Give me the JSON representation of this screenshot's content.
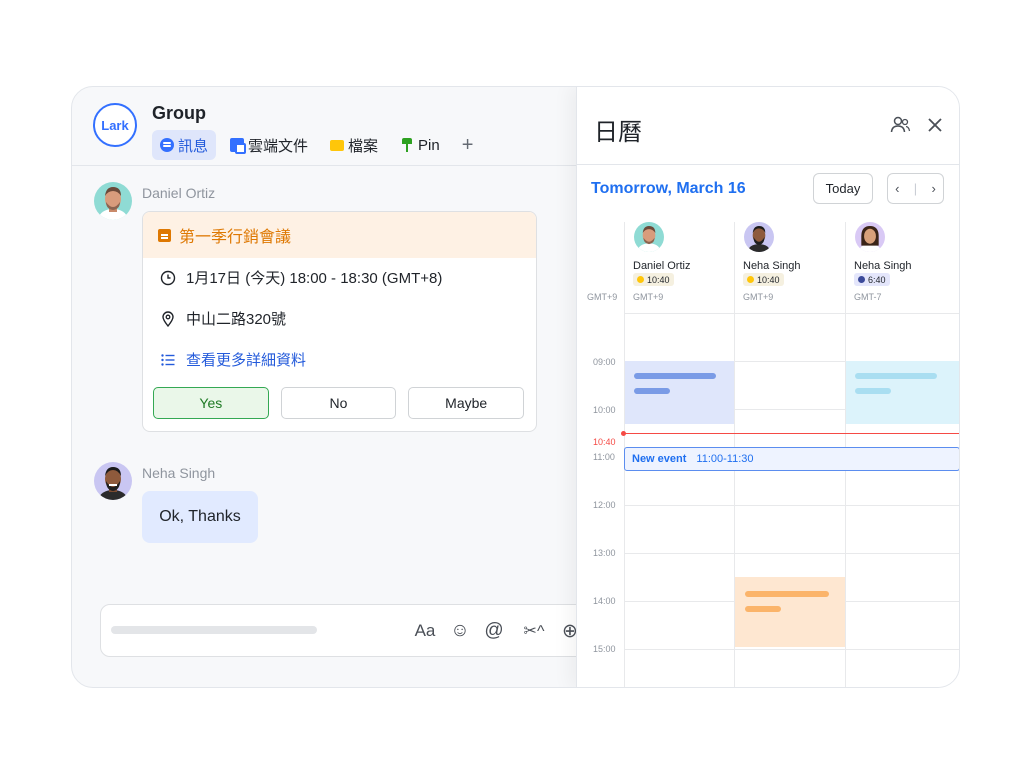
{
  "chat": {
    "logo": "Lark",
    "title": "Group",
    "tabs": [
      {
        "label": "訊息",
        "icon": "message-icon"
      },
      {
        "label": "雲端文件",
        "icon": "doc-icon"
      },
      {
        "label": "檔案",
        "icon": "folder-icon"
      },
      {
        "label": "Pin",
        "icon": "pin-icon"
      },
      {
        "label": "+",
        "icon": "plus-icon"
      }
    ],
    "messages": [
      {
        "sender": "Daniel Ortiz"
      },
      {
        "sender": "Neha Singh",
        "text": "Ok, Thanks"
      }
    ],
    "event": {
      "title": "第一季行銷會議",
      "time": "1月17日 (今天) 18:00 - 18:30 (GMT+8)",
      "location": "中山二路320號",
      "details_link": "查看更多詳細資料",
      "rsvp": {
        "yes": "Yes",
        "no": "No",
        "maybe": "Maybe"
      }
    },
    "composer": {
      "tools": [
        "Aa",
        "☺",
        "@",
        "✂^",
        "⊕"
      ]
    }
  },
  "calendar": {
    "title": "日曆",
    "date": "Tomorrow, March 16",
    "today_label": "Today",
    "prev": "‹",
    "sep": "|",
    "next": "›",
    "tz_label": "GMT+9",
    "people": [
      {
        "name": "Daniel Ortiz",
        "time": "10:40",
        "tz": "GMT+9",
        "period": "day"
      },
      {
        "name": "Neha Singh",
        "time": "10:40",
        "tz": "GMT+9",
        "period": "day"
      },
      {
        "name": "Neha Singh",
        "time": "6:40",
        "tz": "GMT-7",
        "period": "night"
      }
    ],
    "hours": [
      "09:00",
      "10:00",
      "11:00",
      "12:00",
      "13:00",
      "14:00",
      "15:00"
    ],
    "now_label": "10:40",
    "new_event": {
      "title": "New event",
      "time": "11:00-11:30"
    }
  },
  "colors": {
    "accent": "#3370ff",
    "event_orange": "#de7802",
    "now_line": "#f54a45",
    "block_blue": "#dfe6fb",
    "block_cyan": "#dcf3fb",
    "block_orange": "#fee7d1"
  }
}
